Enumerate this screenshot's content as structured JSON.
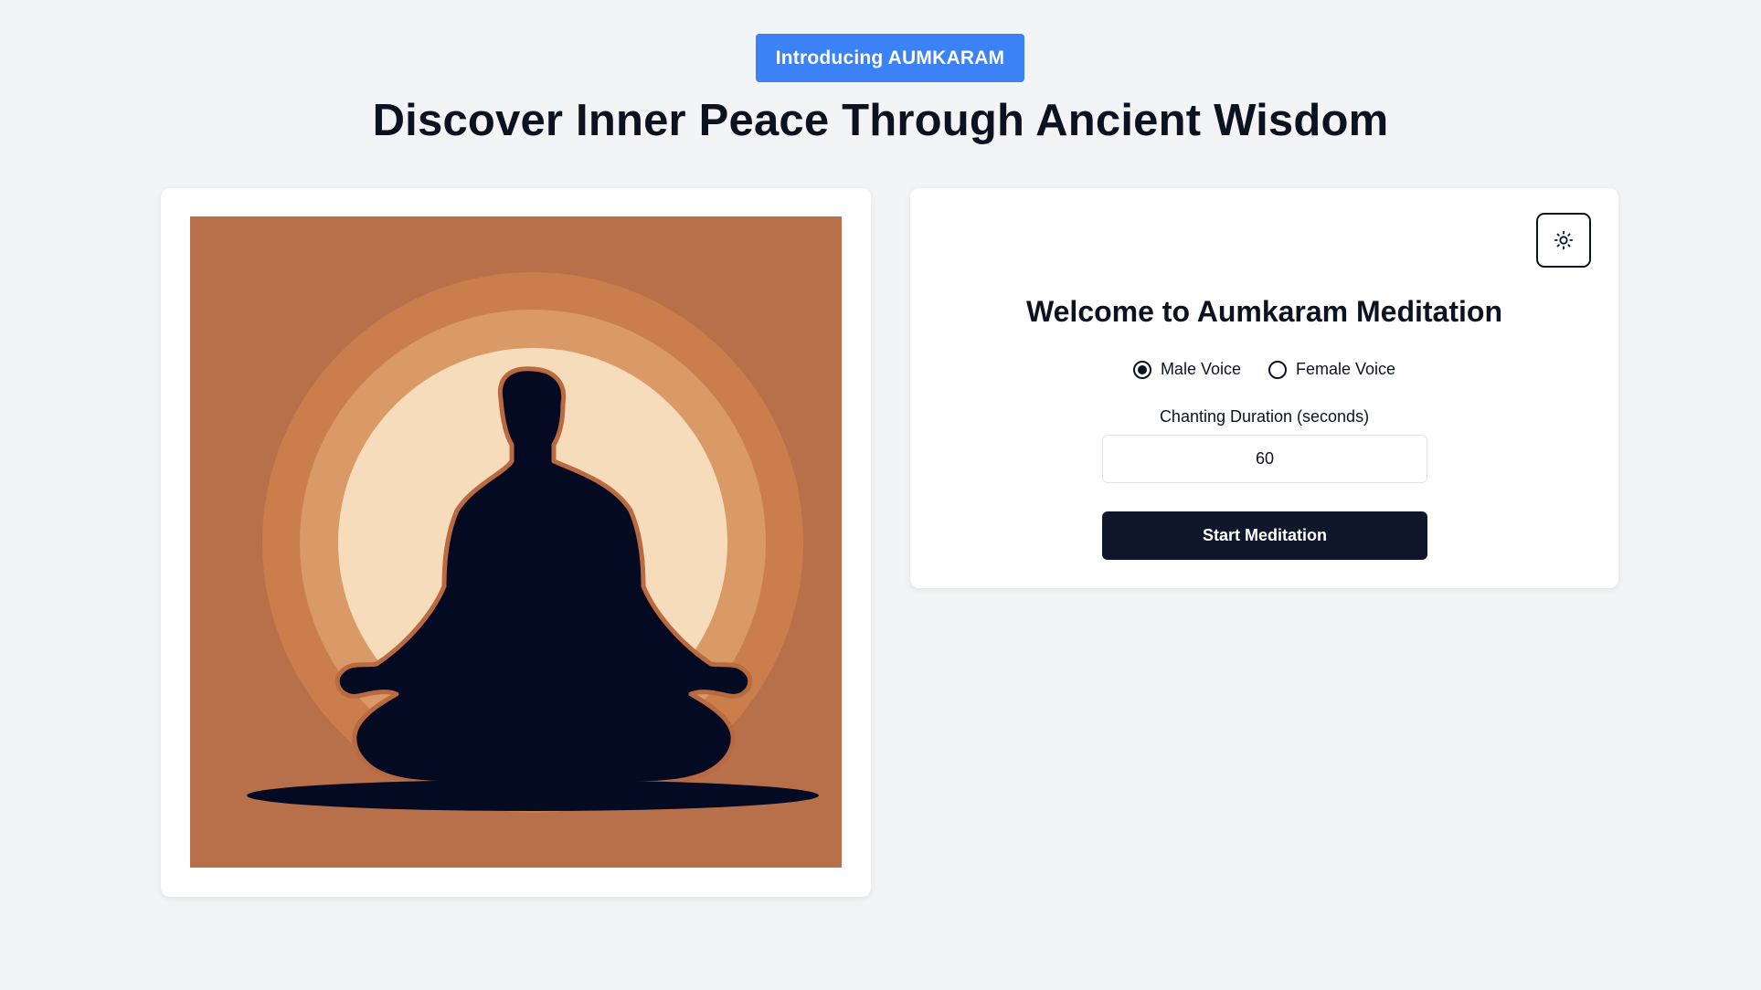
{
  "header": {
    "badge_label": "Introducing AUMKARAM",
    "title": "Discover Inner Peace Through Ancient Wisdom"
  },
  "illustration": {
    "subject": "meditating figure silhouette",
    "colors": {
      "background": "#b8704a",
      "outer_ring": "#c97e4b",
      "middle_ring": "#d99a68",
      "sun": "#f6dcba",
      "silhouette": "#050a23",
      "outline": "#b96a40"
    }
  },
  "welcome": {
    "theme_toggle_icon": "sun-icon",
    "title": "Welcome to Aumkaram Meditation",
    "voice_options": [
      {
        "label": "Male Voice",
        "selected": true
      },
      {
        "label": "Female Voice",
        "selected": false
      }
    ],
    "duration_label": "Chanting Duration (seconds)",
    "duration_value": "60",
    "start_button_label": "Start Meditation"
  },
  "colors": {
    "page_background": "#f3f4f6",
    "badge": "#3b82f6",
    "primary_button": "#0f172a",
    "text": "#0b1220"
  }
}
